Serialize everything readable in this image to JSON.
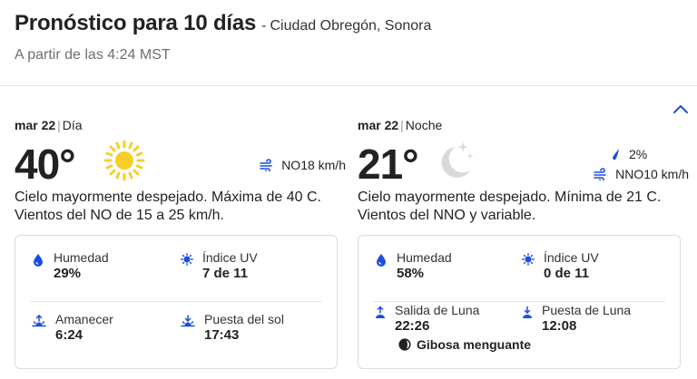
{
  "header": {
    "title": "Pronóstico para 10 días",
    "separator": "-",
    "location": "Ciudad Obregón, Sonora",
    "as_of": "A partir de las 4:24 MST"
  },
  "day": {
    "date": "mar 22",
    "period": "Día",
    "temp": "40°",
    "condition_icon": "sun-icon",
    "wind": "NO18 km/h",
    "description": "Cielo mayormente despejado. Máxima de 40 C. Vientos del NO de 15 a 25 km/h.",
    "metrics": {
      "humidity_label": "Humedad",
      "humidity_value": "29%",
      "uv_label": "Índice UV",
      "uv_value": "7 de 11",
      "sunrise_label": "Amanecer",
      "sunrise_value": "6:24",
      "sunset_label": "Puesta del sol",
      "sunset_value": "17:43"
    }
  },
  "night": {
    "date": "mar 22",
    "period": "Noche",
    "temp": "21°",
    "condition_icon": "moon-stars-icon",
    "precip": "2%",
    "wind": "NNO10 km/h",
    "description": "Cielo mayormente despejado. Mínima de 21 C. Vientos del NNO y variable.",
    "metrics": {
      "humidity_label": "Humedad",
      "humidity_value": "58%",
      "uv_label": "Índice UV",
      "uv_value": "0 de 11",
      "moonrise_label": "Salida de Luna",
      "moonrise_value": "22:26",
      "moonset_label": "Puesta de Luna",
      "moonset_value": "12:08",
      "moon_phase": "Gibosa menguante"
    }
  },
  "colors": {
    "accent": "#1b4de4",
    "sun": "#f6cf2a",
    "moon": "#d9d9d9",
    "text": "#222222",
    "muted": "#6f6f6f"
  }
}
